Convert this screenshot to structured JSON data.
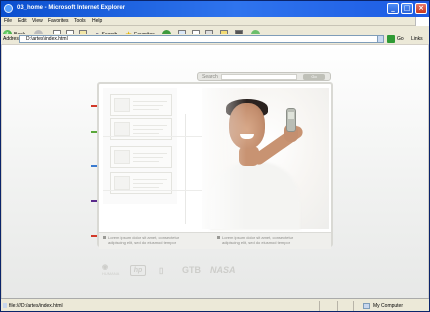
{
  "window": {
    "title": "03_home - Microsoft Internet Explorer",
    "controls": {
      "minimize": "_",
      "maximize": "□",
      "close": "×"
    }
  },
  "menubar": {
    "items": [
      "File",
      "Edit",
      "View",
      "Favorites",
      "Tools",
      "Help"
    ]
  },
  "toolbar": {
    "back_label": "Back",
    "search_label": "Search",
    "favorites_label": "Favorites"
  },
  "addressbar": {
    "label": "Address",
    "url": "D:\\artes\\index.html",
    "go_label": "Go",
    "links_label": "Links"
  },
  "status": {
    "text": "file:///D:/artes/index.html",
    "zone": "My Computer"
  },
  "page": {
    "search": {
      "label": "Search",
      "button": "Go"
    },
    "captions": [
      {
        "line1": "Lorem ipsum dolor sit amet, consectetur",
        "line2": "adipiscing elit, sed do eiusmod tempor"
      },
      {
        "line1": "Lorem ipsum dolor sit amet, consectetur",
        "line2": "adipiscing elit, sed do eiusmod tempor"
      }
    ],
    "side_markers": [
      "#d23a2a",
      "#5aa83a",
      "#3a7bd0",
      "#5a2a8c",
      "#d23a2a"
    ],
    "logos": [
      {
        "name": "humana",
        "text": "HUMANA"
      },
      {
        "name": "hp",
        "text": "hp"
      },
      {
        "name": "gtb",
        "text": "GTB"
      },
      {
        "name": "nasa",
        "text": "NASA"
      }
    ]
  }
}
